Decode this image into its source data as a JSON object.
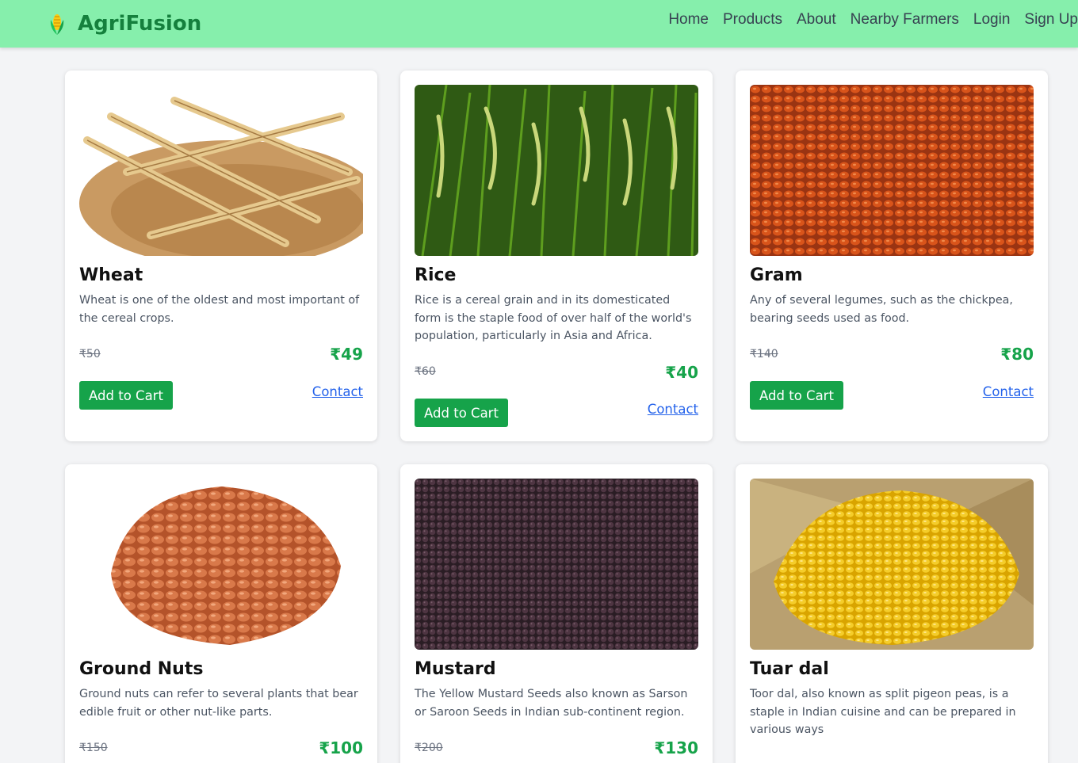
{
  "brand": {
    "name": "AgriFusion",
    "icon": "corn-icon"
  },
  "nav": [
    "Home",
    "Products",
    "About",
    "Nearby Farmers",
    "Login",
    "Sign Up"
  ],
  "colors": {
    "navbar": "#86efac",
    "brand": "#15803d",
    "price": "#16a34a",
    "button": "#16a34a",
    "link": "#2563eb"
  },
  "products": [
    {
      "name": "Wheat",
      "desc": "Wheat is one of the oldest and most important of the cereal crops.",
      "old_price": "₹50",
      "price": "₹49",
      "cart": "Add to Cart",
      "contact": "Contact"
    },
    {
      "name": "Rice",
      "desc": "Rice is a cereal grain and in its domesticated form is the staple food of over half of the world's population, particularly in Asia and Africa.",
      "old_price": "₹60",
      "price": "₹40",
      "cart": "Add to Cart",
      "contact": "Contact"
    },
    {
      "name": "Gram",
      "desc": "Any of several legumes, such as the chickpea, bearing seeds used as food.",
      "old_price": "₹140",
      "price": "₹80",
      "cart": "Add to Cart",
      "contact": "Contact"
    },
    {
      "name": "Ground Nuts",
      "desc": "Ground nuts can refer to several plants that bear edible fruit or other nut-like parts.",
      "old_price": "₹150",
      "price": "₹100"
    },
    {
      "name": "Mustard",
      "desc": "The Yellow Mustard Seeds also known as Sarson or Saroon Seeds in Indian sub-continent region.",
      "old_price": "₹200",
      "price": "₹130"
    },
    {
      "name": "Tuar dal",
      "desc": "Toor dal, also known as split pigeon peas, is a staple in Indian cuisine and can be prepared in various ways"
    }
  ]
}
